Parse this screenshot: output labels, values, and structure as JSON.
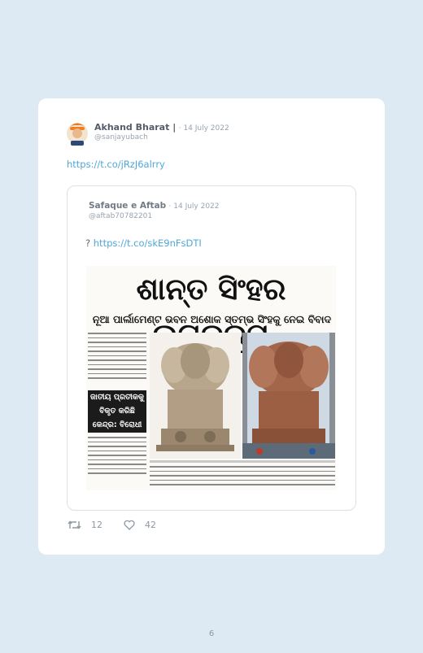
{
  "tweet": {
    "author_name": "Akhand Bharat |",
    "date": "14 July 2022",
    "handle": "@sanjayubach",
    "link": "https://t.co/jRzJ6alrry",
    "retweets": "12",
    "likes": "42"
  },
  "quoted": {
    "author_name": "Safaque e Aftab",
    "date": "14 July 2022",
    "handle": "@aftab70782201",
    "text_prefix": "?",
    "link": "https://t.co/skE9nFsDTI"
  },
  "clipping": {
    "headline": "ଶାନ୍ତ ସିଂହର ଉଗ୍ରରୂପ",
    "subhead": "ନୂଆ ପାର୍ଲାମେଣ୍ଟ ଭବନ ଅଶୋକ ସ୍ତମ୍ଭ ସିଂହକୁ ନେଇ ବିବାଦ",
    "boxout": [
      "ଜାତୀୟ ପ୍ରତୀକକୁ",
      "ବିକୃତ କରିଛି",
      "କେନ୍ଦ୍ର: ବିରୋଧୀ"
    ]
  },
  "page_number": "6",
  "colors": {
    "background": "#dde9f3",
    "link": "#4fa7d8",
    "muted": "#8d97a0"
  },
  "icons": [
    "retweet-icon",
    "heart-icon"
  ]
}
